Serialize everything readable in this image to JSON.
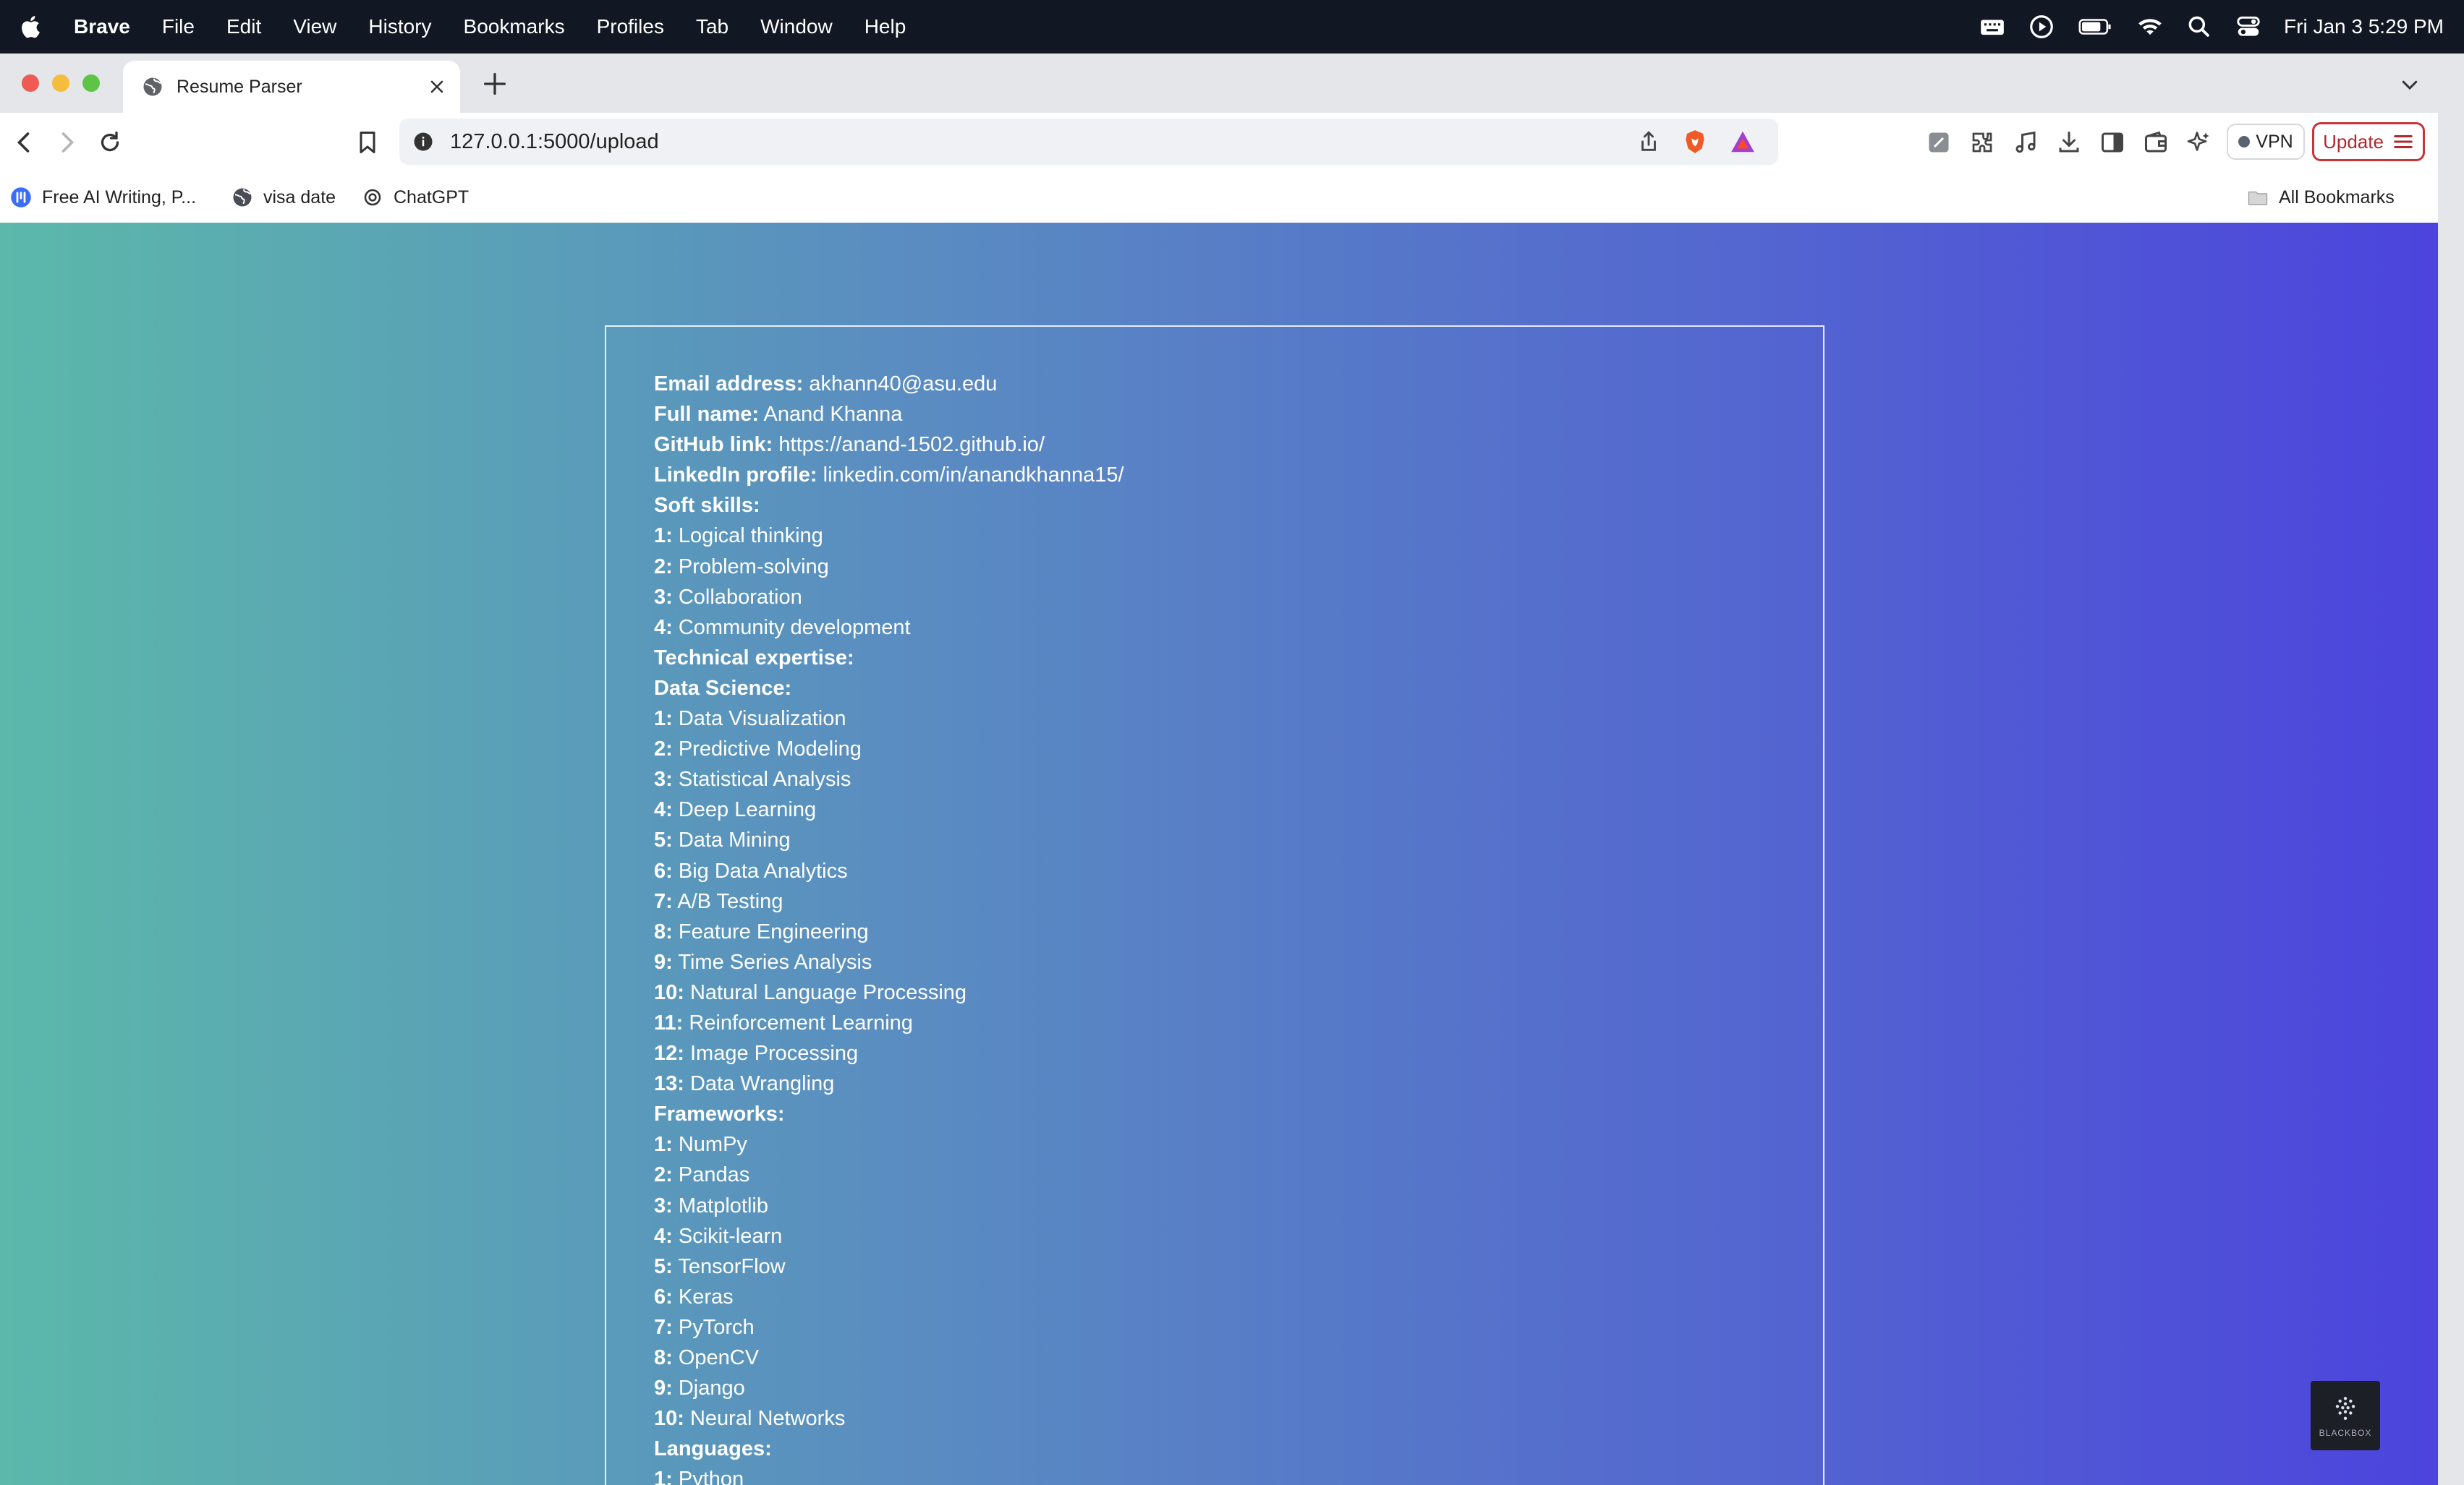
{
  "menubar": {
    "app": "Brave",
    "items": [
      "File",
      "Edit",
      "View",
      "History",
      "Bookmarks",
      "Profiles",
      "Tab",
      "Window",
      "Help"
    ],
    "clock": "Fri Jan 3  5:29 PM"
  },
  "tab": {
    "title": "Resume Parser"
  },
  "address": {
    "url": "127.0.0.1:5000/upload"
  },
  "toolbar": {
    "vpn_label": "VPN",
    "update_label": "Update"
  },
  "bookmarks": {
    "items": [
      "Free AI Writing, P...",
      "visa date",
      "ChatGPT"
    ],
    "all_label": "All Bookmarks"
  },
  "resume": {
    "lines": [
      {
        "k": "Email address:",
        "v": " akhann40@asu.edu"
      },
      {
        "k": "Full name:",
        "v": " Anand Khanna"
      },
      {
        "k": "GitHub link:",
        "v": " https://anand-1502.github.io/"
      },
      {
        "k": "LinkedIn profile:",
        "v": " linkedin.com/in/anandkhanna15/"
      },
      {
        "k": "Soft skills:",
        "v": ""
      },
      {
        "k": "1:",
        "v": " Logical thinking"
      },
      {
        "k": "2:",
        "v": " Problem-solving"
      },
      {
        "k": "3:",
        "v": " Collaboration"
      },
      {
        "k": "4:",
        "v": " Community development"
      },
      {
        "k": "Technical expertise:",
        "v": ""
      },
      {
        "k": "Data Science:",
        "v": ""
      },
      {
        "k": "1:",
        "v": " Data Visualization"
      },
      {
        "k": "2:",
        "v": " Predictive Modeling"
      },
      {
        "k": "3:",
        "v": " Statistical Analysis"
      },
      {
        "k": "4:",
        "v": " Deep Learning"
      },
      {
        "k": "5:",
        "v": " Data Mining"
      },
      {
        "k": "6:",
        "v": " Big Data Analytics"
      },
      {
        "k": "7:",
        "v": " A/B Testing"
      },
      {
        "k": "8:",
        "v": " Feature Engineering"
      },
      {
        "k": "9:",
        "v": " Time Series Analysis"
      },
      {
        "k": "10:",
        "v": " Natural Language Processing"
      },
      {
        "k": "11:",
        "v": " Reinforcement Learning"
      },
      {
        "k": "12:",
        "v": " Image Processing"
      },
      {
        "k": "13:",
        "v": " Data Wrangling"
      },
      {
        "k": "Frameworks:",
        "v": ""
      },
      {
        "k": "1:",
        "v": " NumPy"
      },
      {
        "k": "2:",
        "v": " Pandas"
      },
      {
        "k": "3:",
        "v": " Matplotlib"
      },
      {
        "k": "4:",
        "v": " Scikit-learn"
      },
      {
        "k": "5:",
        "v": " TensorFlow"
      },
      {
        "k": "6:",
        "v": " Keras"
      },
      {
        "k": "7:",
        "v": " PyTorch"
      },
      {
        "k": "8:",
        "v": " OpenCV"
      },
      {
        "k": "9:",
        "v": " Django"
      },
      {
        "k": "10:",
        "v": " Neural Networks"
      },
      {
        "k": "Languages:",
        "v": ""
      },
      {
        "k": "1:",
        "v": " Python"
      }
    ]
  },
  "blackbox": {
    "label": "BLACKBOX"
  },
  "colors": {
    "gradient_start": "#5bb8aa",
    "gradient_end": "#4c44dd",
    "update_accent": "#c8343a"
  }
}
